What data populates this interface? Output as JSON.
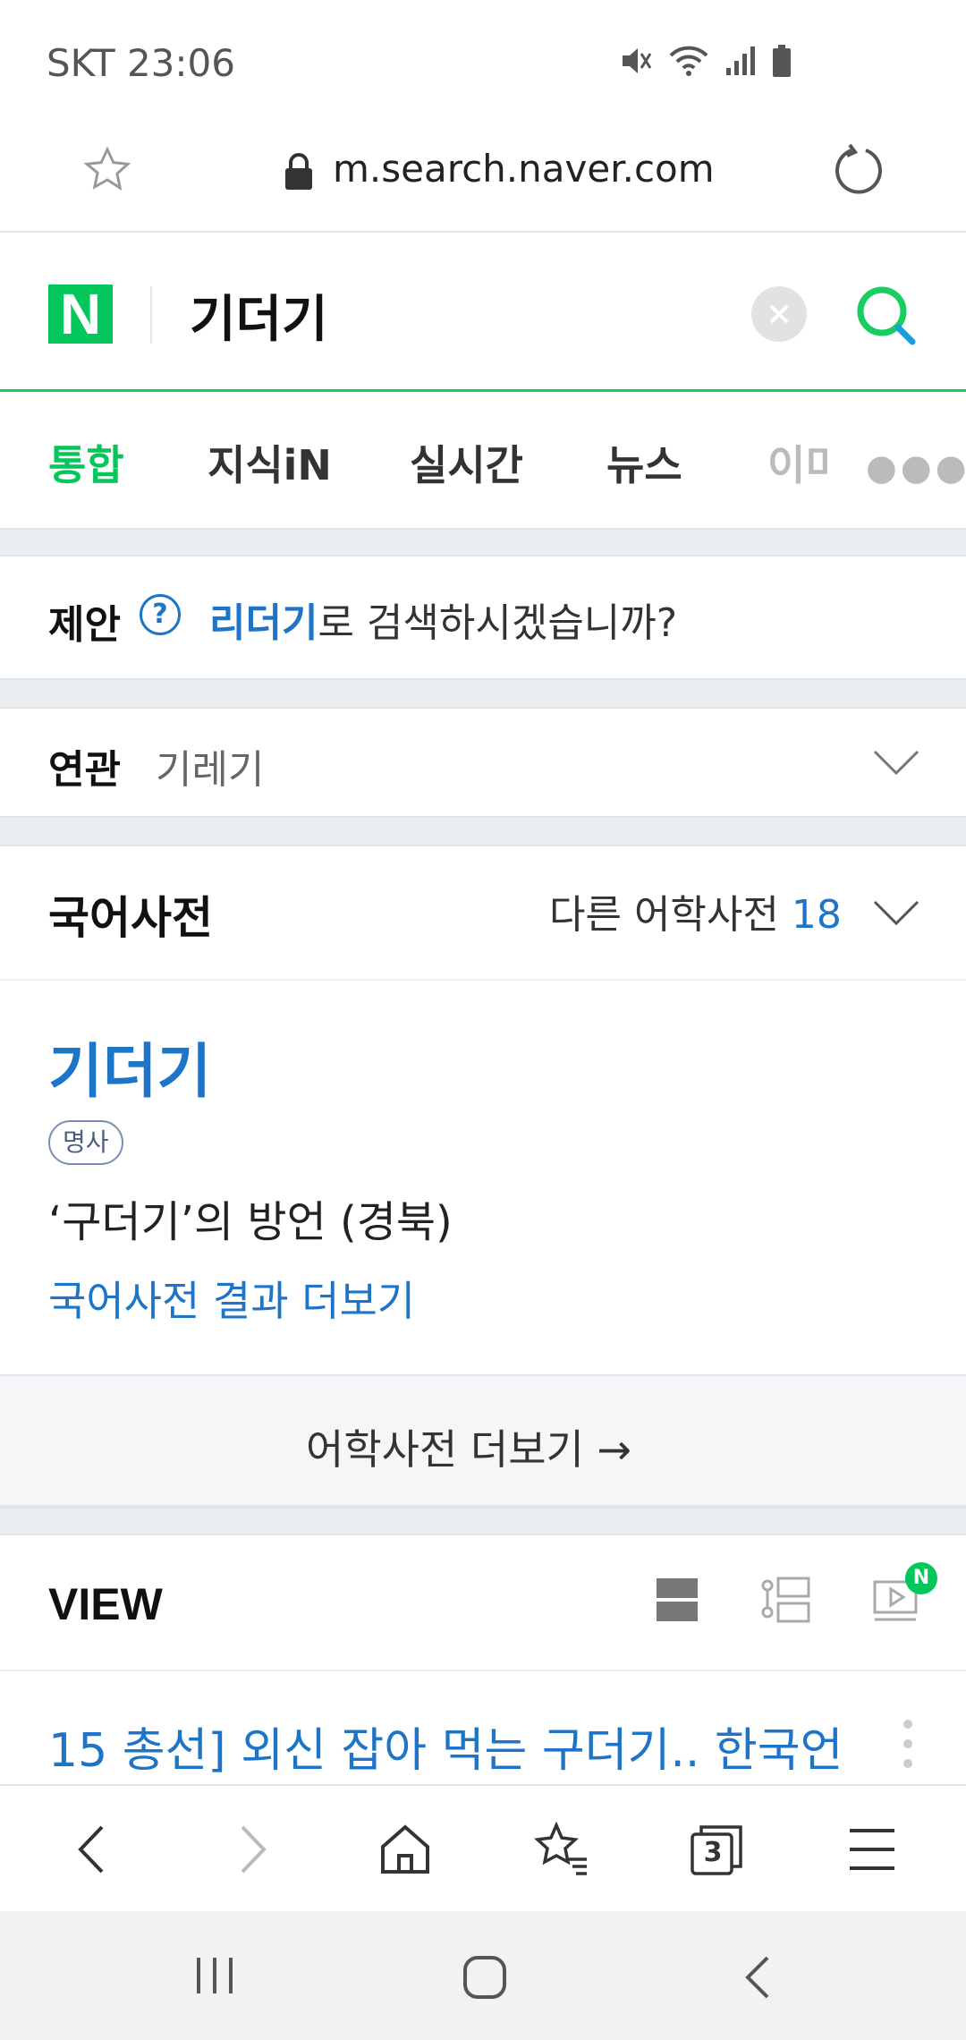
{
  "status_bar": {
    "carrier_time": "SKT 23:06"
  },
  "url_bar": {
    "url": "m.search.naver.com"
  },
  "search": {
    "logo_letter": "N",
    "query": "기더기"
  },
  "tabs": [
    {
      "label": "통합",
      "active": true
    },
    {
      "label": "지식iN"
    },
    {
      "label": "실시간"
    },
    {
      "label": "뉴스"
    },
    {
      "label": "이미지"
    }
  ],
  "suggest": {
    "label": "제안",
    "help": "?",
    "link": "리더기",
    "rest": "로 검색하시겠습니까?"
  },
  "related": {
    "label": "연관",
    "item": "기레기"
  },
  "dictionary": {
    "title": "국어사전",
    "other_label": "다른 어학사전",
    "other_count": "18",
    "word": "기더기",
    "pos": "명사",
    "definition": "‘구더기’의 방언 (경북)",
    "more_link": "국어사전 결과 더보기"
  },
  "lang_more": {
    "label": "어학사전 더보기 →"
  },
  "view": {
    "title": "VIEW",
    "badge": "N",
    "result_title": "15 총선] 외신 잡아 먹는 구더기.. 한국언"
  },
  "toolbar": {
    "tab_count": "3"
  },
  "colors": {
    "naver_green": "#03c75a",
    "link_blue": "#1e74c7"
  }
}
